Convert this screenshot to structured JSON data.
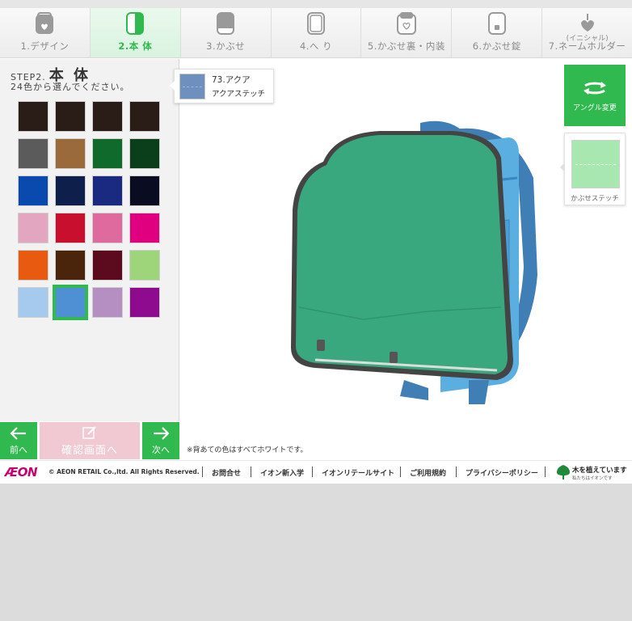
{
  "steps": [
    {
      "label": "1.デザイン",
      "active": false
    },
    {
      "label": "2.本 体",
      "active": true
    },
    {
      "label": "3.かぶせ",
      "active": false
    },
    {
      "label": "4.へ り",
      "active": false
    },
    {
      "label": "5.かぶせ裏・内装",
      "active": false
    },
    {
      "label": "6.かぶせ錠",
      "active": false
    },
    {
      "label": "7.ネームホルダー",
      "sublabel": "(イニシャル)",
      "active": false
    }
  ],
  "panel": {
    "step_prefix": "STEP2.",
    "step_title": "本 体",
    "instruction": "24色から選んでください。"
  },
  "swatches": [
    "#2a1d18",
    "#2a1d18",
    "#2a1d18",
    "#2a1d18",
    "#5b5b5b",
    "#9a6a3a",
    "#0e6b2c",
    "#0b3f1c",
    "#0a4aae",
    "#0d1f4a",
    "#1a2a80",
    "#0a0d22",
    "#e3a6c0",
    "#c8102e",
    "#de6a9e",
    "#e0007f",
    "#e85a10",
    "#4a250c",
    "#5c0a1e",
    "#9ed47a",
    "#a6caee",
    "#4f8fd4",
    "#b58ec2",
    "#8e0a8e"
  ],
  "selected_swatch_index": 21,
  "tooltip": {
    "name": "73.アクア",
    "stitch": "アクアステッチ",
    "color": "#6f8fbf"
  },
  "buttons": {
    "prev": "前へ",
    "confirm": "確認画面へ",
    "next": "次へ",
    "angle": "アングル変更"
  },
  "stitch_panel": {
    "label": "かぶせステッチ",
    "color": "#a8e8b0"
  },
  "bag": {
    "flap_color": "#3aa87e",
    "body_color": "#5aaee0",
    "edge_color": "#444444"
  },
  "background_note": "※背あての色はすべてホワイトです。",
  "footer": {
    "logo": "ÆON",
    "copyright": "© AEON RETAIL Co.,ltd. All Rights Reserved.",
    "links": [
      "お問合せ",
      "イオン新入学",
      "イオンリテールサイト",
      "ご利用規約",
      "プライバシーポリシー"
    ],
    "tree_text": "木を植えています",
    "tree_sub": "私たちはイオンです"
  },
  "colors": {
    "accent_green": "#2fb94e",
    "confirm_pink": "#f0c9d2"
  }
}
